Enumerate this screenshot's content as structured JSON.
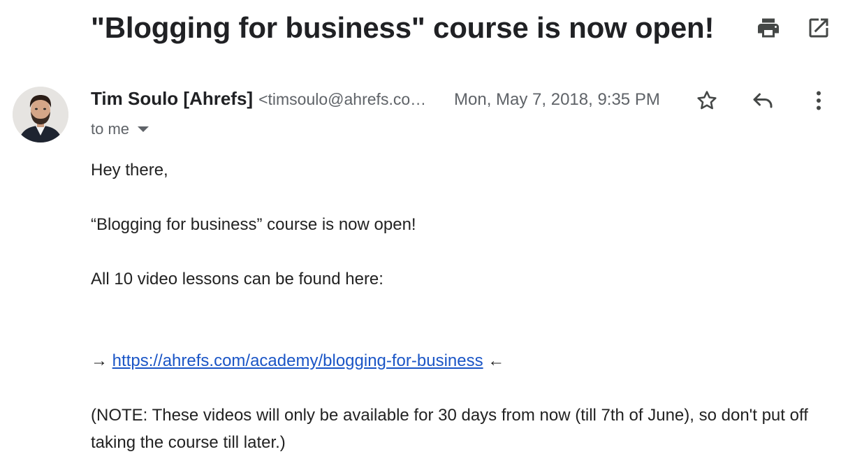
{
  "email": {
    "subject": "\"Blogging for business\" course is now open!",
    "sender_name": "Tim Soulo [Ahrefs]",
    "sender_email": "<timsoulo@ahrefs.co…",
    "date": "Mon, May 7, 2018, 9:35 PM",
    "recipient": "to me",
    "body": {
      "greeting": "Hey there,",
      "line1": "“Blogging for business” course is now open!",
      "line2": "All 10 video lessons can be found here:",
      "arrow_right": "→",
      "link": "https://ahrefs.com/academy/blogging-for-business",
      "arrow_left": "←",
      "note": "(NOTE: These videos will only be available for 30 days from now (till 7th of June), so don't put off taking the course till later.)"
    }
  },
  "icons": {
    "print": "print-icon",
    "open_new_window": "open-in-new-window-icon",
    "star": "star-icon",
    "reply": "reply-icon",
    "more": "more-vertical-icon",
    "dropdown": "chevron-down-icon"
  },
  "colors": {
    "link": "#1a55c6",
    "secondary_text": "#5f6368",
    "primary_text": "#202124"
  }
}
